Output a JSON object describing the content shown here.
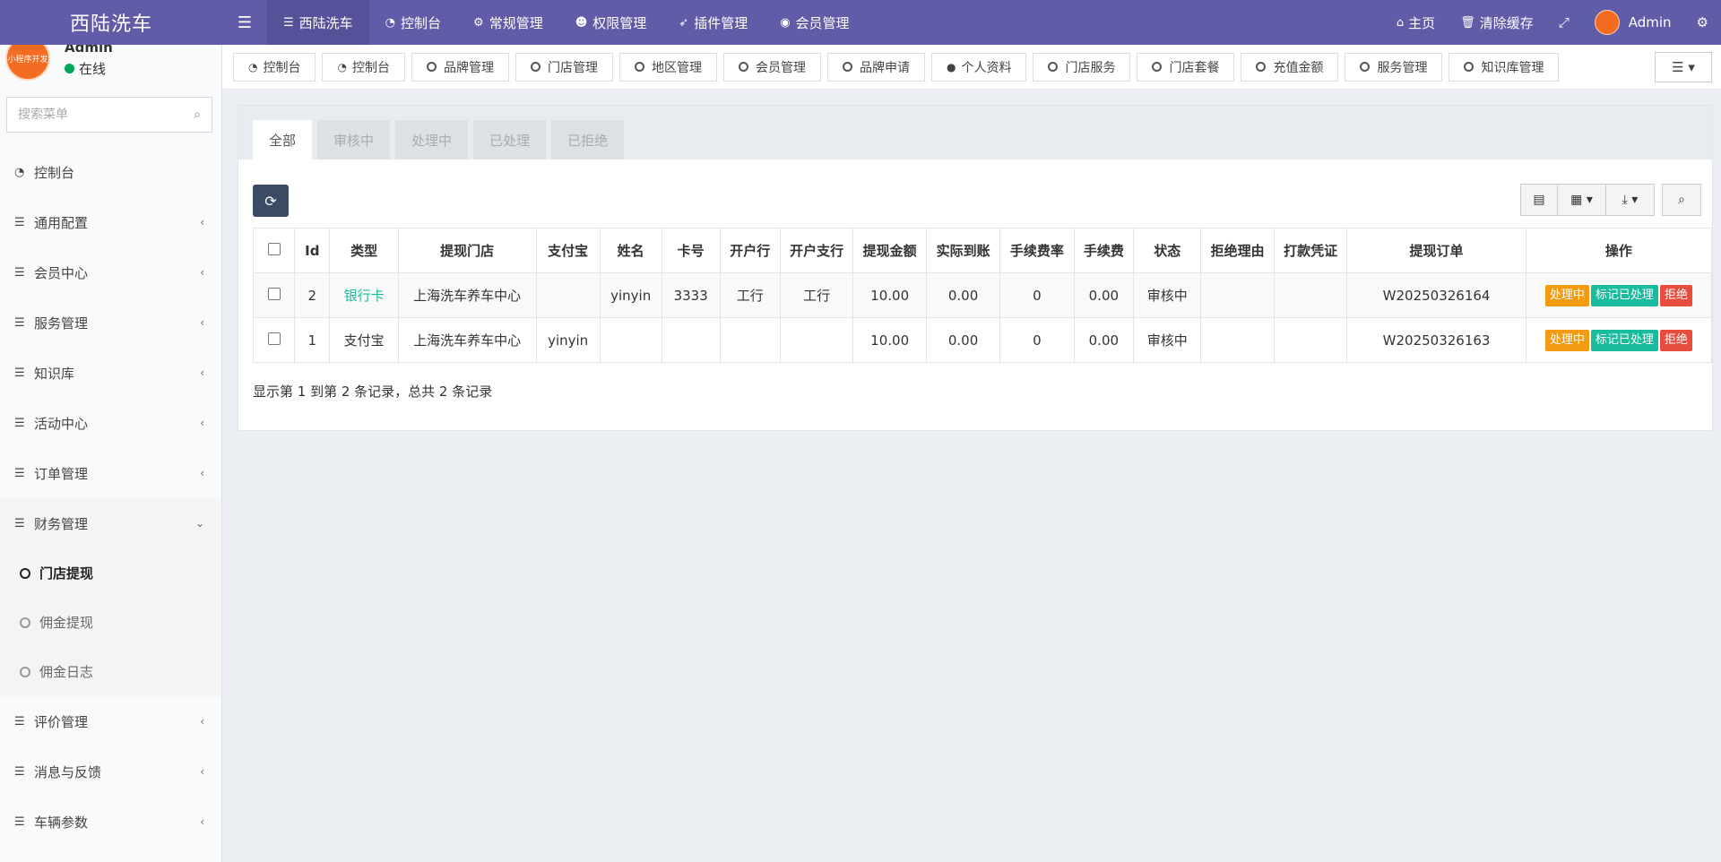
{
  "brand": "西陆洗车",
  "topnav": [
    {
      "icon": "list-icon",
      "glyph": "☰",
      "label": "西陆洗车"
    },
    {
      "icon": "dashboard-icon",
      "glyph": "◔",
      "label": "控制台"
    },
    {
      "icon": "cogs-icon",
      "glyph": "⚙",
      "label": "常规管理"
    },
    {
      "icon": "users-icon",
      "glyph": "👥",
      "label": "权限管理"
    },
    {
      "icon": "rocket-icon",
      "glyph": "🚀",
      "label": "插件管理"
    },
    {
      "icon": "user-circle-icon",
      "glyph": "◉",
      "label": "会员管理"
    }
  ],
  "topright": {
    "home": "主页",
    "clear_cache": "清除缓存",
    "admin": "Admin"
  },
  "user": {
    "name": "Admin",
    "status": "在线",
    "avatar_text": "小程序开发"
  },
  "search": {
    "placeholder": "搜索菜单"
  },
  "menu": [
    {
      "label": "控制台"
    },
    {
      "label": "通用配置"
    },
    {
      "label": "会员中心"
    },
    {
      "label": "服务管理"
    },
    {
      "label": "知识库"
    },
    {
      "label": "活动中心"
    },
    {
      "label": "订单管理"
    },
    {
      "label": "财务管理"
    }
  ],
  "submenu": [
    {
      "label": "门店提现"
    },
    {
      "label": "佣金提现"
    },
    {
      "label": "佣金日志"
    }
  ],
  "menu_after": [
    {
      "label": "评价管理"
    },
    {
      "label": "消息与反馈"
    },
    {
      "label": "车辆参数"
    }
  ],
  "tabs": [
    "控制台",
    "控制台",
    "品牌管理",
    "门店管理",
    "地区管理",
    "会员管理",
    "品牌申请",
    "个人资料",
    "门店服务",
    "门店套餐",
    "充值金额",
    "服务管理",
    "知识库管理"
  ],
  "filter_tabs": [
    "全部",
    "审核中",
    "处理中",
    "已处理",
    "已拒绝"
  ],
  "table": {
    "headers": [
      "Id",
      "类型",
      "提现门店",
      "支付宝",
      "姓名",
      "卡号",
      "开户行",
      "开户支行",
      "提现金额",
      "实际到账",
      "手续费率",
      "手续费",
      "状态",
      "拒绝理由",
      "打款凭证",
      "提现订单",
      "操作"
    ],
    "rows": [
      {
        "id": "2",
        "type": "银行卡",
        "store": "上海洗车养车中心",
        "alipay": "",
        "name": "yinyin",
        "card": "3333",
        "bank": "工行",
        "branch": "工行",
        "amount": "10.00",
        "actual": "0.00",
        "rate": "0",
        "fee": "0.00",
        "status": "审核中",
        "reason": "",
        "voucher": "",
        "order": "W20250326164"
      },
      {
        "id": "1",
        "type": "支付宝",
        "store": "上海洗车养车中心",
        "alipay": "yinyin",
        "name": "",
        "card": "",
        "bank": "",
        "branch": "",
        "amount": "10.00",
        "actual": "0.00",
        "rate": "0",
        "fee": "0.00",
        "status": "审核中",
        "reason": "",
        "voucher": "",
        "order": "W20250326163"
      }
    ],
    "actions": {
      "processing": "处理中",
      "mark_done": "标记已处理",
      "reject": "拒绝"
    }
  },
  "summary": "显示第 1 到第 2 条记录，总共 2 条记录"
}
